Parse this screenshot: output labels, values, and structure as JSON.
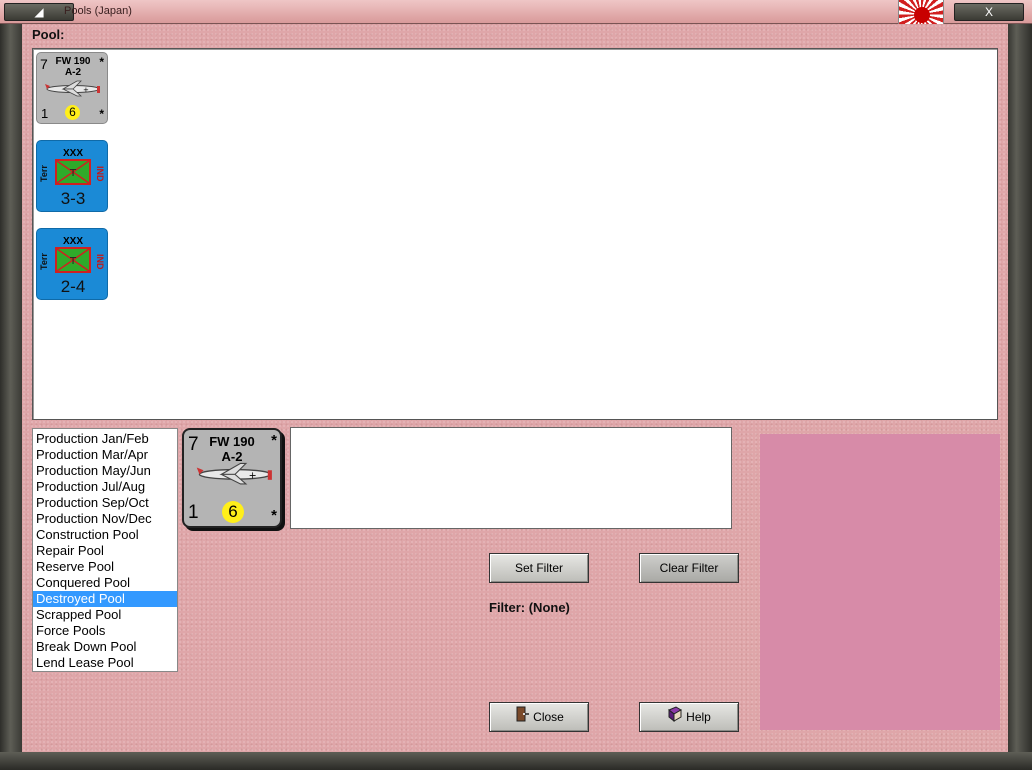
{
  "window": {
    "title": "Pools (Japan)",
    "left_btn_glyph": "◢",
    "close_glyph": "X",
    "flag_icon": "rising-sun-flag"
  },
  "pool": {
    "label": "Pool:",
    "units": [
      {
        "kind": "air",
        "attack": "7",
        "name_line1": "FW 190",
        "name_line2": "A-2",
        "corner_tr": "*",
        "move": "1",
        "range": "6",
        "corner_br": "*"
      },
      {
        "kind": "land",
        "size": "XXX",
        "left_label": "Terr",
        "right_label": "IND",
        "symbol": "T",
        "strength": "3-3"
      },
      {
        "kind": "land",
        "size": "XXX",
        "left_label": "Terr",
        "right_label": "IND",
        "symbol": "T",
        "strength": "2-4"
      }
    ]
  },
  "pool_list": {
    "items": [
      "Production Jan/Feb",
      "Production Mar/Apr",
      "Production May/Jun",
      "Production Jul/Aug",
      "Production Sep/Oct",
      "Production Nov/Dec",
      "Construction Pool",
      "Repair Pool",
      "Reserve Pool",
      "Conquered Pool",
      "Destroyed Pool",
      "Scrapped Pool",
      "Force Pools",
      "Break Down Pool",
      "Lend Lease Pool"
    ],
    "selected": "Destroyed Pool"
  },
  "selected_unit": {
    "attack": "7",
    "name_line1": "FW 190",
    "name_line2": "A-2",
    "corner_tr": "*",
    "move": "1",
    "range": "6",
    "corner_br": "*"
  },
  "buttons": {
    "set_filter": "Set Filter",
    "clear_filter": "Clear Filter",
    "close": "Close",
    "help": "Help"
  },
  "filter": {
    "text": "Filter: (None)"
  },
  "colors": {
    "background": "#dfa6a9",
    "selection": "#3399ff",
    "right_panel": "#d78ba8",
    "land_counter": "#1b8ad6",
    "air_counter": "#b7b7b7"
  }
}
